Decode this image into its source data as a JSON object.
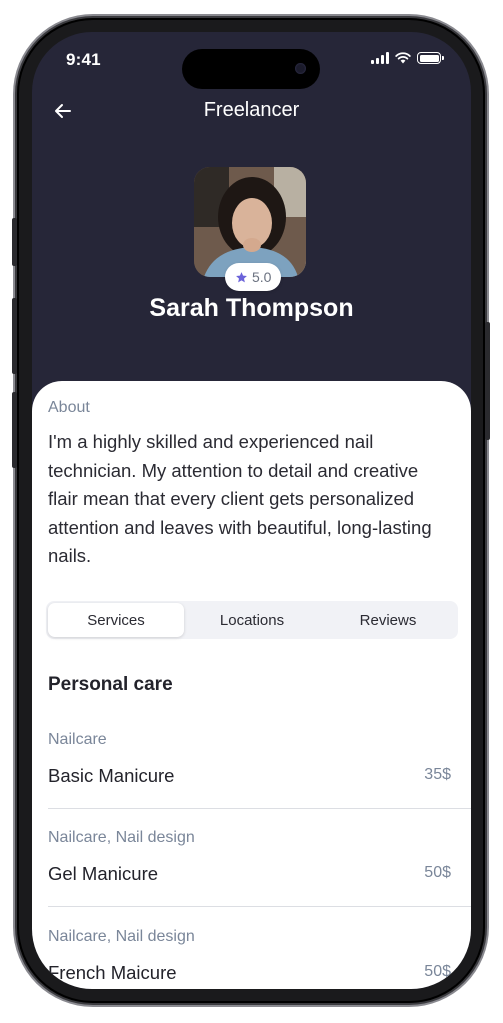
{
  "status_bar": {
    "time": "9:41"
  },
  "header": {
    "title": "Freelancer",
    "back_icon": "arrow-left-icon"
  },
  "profile": {
    "name": "Sarah Thompson",
    "rating": "5.0",
    "rating_icon": "star-icon",
    "star_color": "#6b63d9"
  },
  "about": {
    "label": "About",
    "text": "I'm a highly skilled and experienced nail technician. My attention to detail and creative flair mean that every client gets personalized attention and leaves with beautiful, long-lasting nails."
  },
  "tabs": [
    {
      "label": "Services",
      "active": true
    },
    {
      "label": "Locations",
      "active": false
    },
    {
      "label": "Reviews",
      "active": false
    }
  ],
  "services": {
    "section_title": "Personal care",
    "items": [
      {
        "category": "Nailcare",
        "name": "Basic Manicure",
        "price": "35$"
      },
      {
        "category": "Nailcare, Nail design",
        "name": "Gel Manicure",
        "price": "50$"
      },
      {
        "category": "Nailcare, Nail design",
        "name": "French Maicure",
        "price": "50$"
      }
    ]
  },
  "colors": {
    "header_bg": "#262638",
    "accent": "#6b63d9",
    "muted_text": "#7a8699"
  }
}
